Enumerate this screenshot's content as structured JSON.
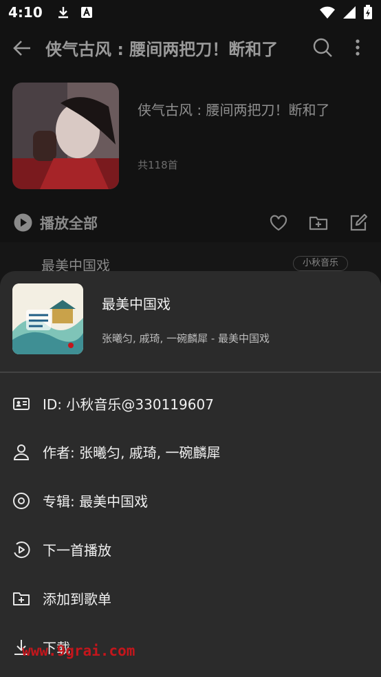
{
  "status_bar": {
    "time": "4:10"
  },
  "header": {
    "title": "侠气古风 : 腰间两把刀！断和了",
    "icons": [
      "arrow-left-icon",
      "search-icon",
      "more-vert-icon"
    ]
  },
  "playlist": {
    "name": "侠气古风 : 腰间两把刀！断和了",
    "count": "共118首"
  },
  "actions": {
    "play_all": "播放全部",
    "icons": [
      "play-circle-icon",
      "heart-icon",
      "folder-add-icon",
      "edit-icon"
    ]
  },
  "list_row": {
    "title": "最美中国戏",
    "badge": "小秋音乐"
  },
  "sheet": {
    "song": {
      "title": "最美中国戏",
      "artist": "张曦匀, 戚琦, 一碗麟犀 - 最美中国戏"
    },
    "menu": [
      {
        "label": "ID: 小秋音乐@330119607",
        "icon": "id-card-icon"
      },
      {
        "label": "作者: 张曦匀, 戚琦, 一碗麟犀",
        "icon": "person-icon"
      },
      {
        "label": "专辑: 最美中国戏",
        "icon": "album-icon"
      },
      {
        "label": "下一首播放",
        "icon": "play-next-icon"
      },
      {
        "label": "添加到歌单",
        "icon": "add-to-folder-icon"
      },
      {
        "label": "下载",
        "icon": "download-icon"
      }
    ]
  },
  "watermark": "www.9grai.com",
  "colors": {
    "background": "#121212",
    "sheet": "#2b2b2b",
    "accent_watermark": "#c4161c"
  }
}
